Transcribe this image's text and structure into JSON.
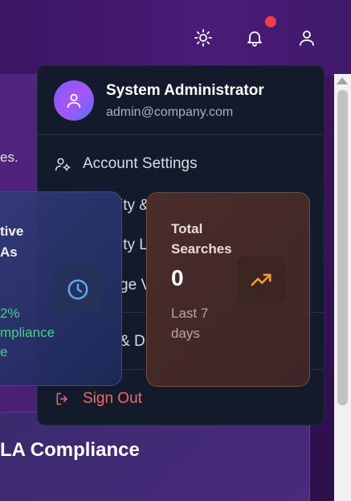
{
  "topbar": {
    "icons": [
      "sun-icon",
      "bell-icon",
      "user-icon"
    ],
    "notification_dot_color": "#ef3b4a"
  },
  "background": {
    "partial_text": "es."
  },
  "user_menu": {
    "name": "System Administrator",
    "email": "admin@company.com",
    "items": [
      {
        "label": "Account Settings",
        "icon": "user-gear-icon"
      },
      {
        "label": "Sign Out",
        "icon": "sign-out-icon"
      }
    ],
    "peek_fragments": [
      "ity &",
      "ity Lo",
      "ge V",
      "& D"
    ]
  },
  "cards": {
    "sla": {
      "title_lines": [
        "tive",
        "As"
      ],
      "value_lines": [
        "2%",
        "mpliance",
        "e"
      ],
      "icon": "clock-icon"
    },
    "searches": {
      "title_lines": [
        "Total",
        "Searches"
      ],
      "value": "0",
      "subtitle_lines": [
        "Last 7",
        "days"
      ],
      "icon": "trend-up-icon"
    }
  },
  "bottom_section": {
    "title": "LA Compliance"
  },
  "colors": {
    "accent_purple": "#7b5cf6",
    "success_green": "#43d18a",
    "danger_red": "#f16a6a",
    "trend_orange": "#f59e3c"
  }
}
